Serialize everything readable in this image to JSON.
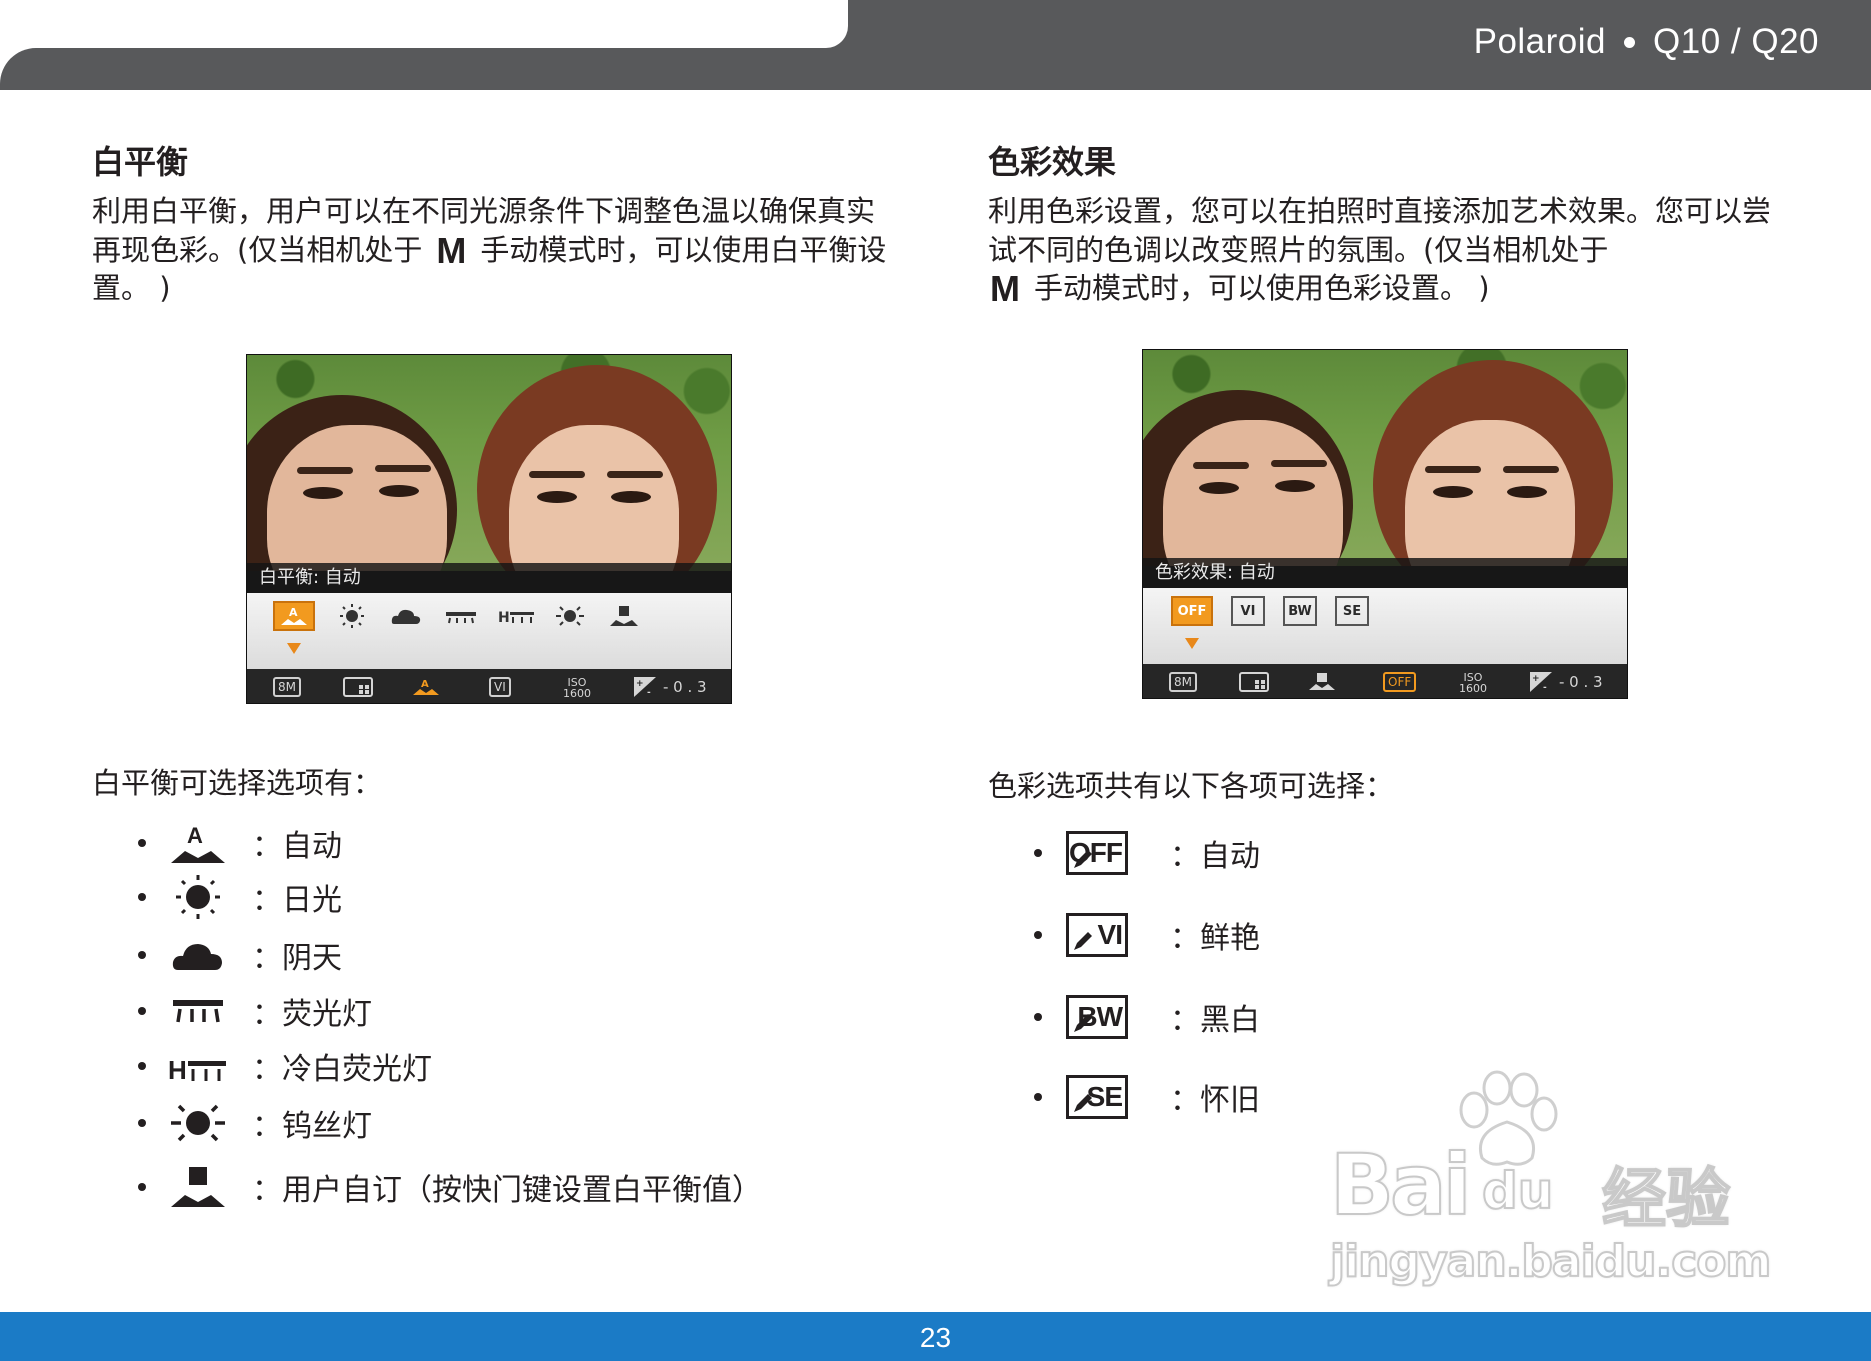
{
  "header": {
    "brand": "Polaroid",
    "model": "Q10 / Q20"
  },
  "footer": {
    "page_number": "23"
  },
  "white_balance": {
    "title": "白平衡",
    "desc_part1": "利用白平衡，用户可以在不同光源条件下调整色温以确保真实再现色彩。(仅当相机处于",
    "mode_glyph": "M",
    "desc_part2": "手动模式时，可以使用白平衡设置。 )",
    "screen_label": "白平衡: 自动",
    "list_title": "白平衡可选择选项有：",
    "options": [
      {
        "icon": "awb-auto-icon",
        "label": "：自动"
      },
      {
        "icon": "daylight-sun-icon",
        "label": "：日光"
      },
      {
        "icon": "cloudy-icon",
        "label": "：阴天"
      },
      {
        "icon": "fluorescent-icon",
        "label": "：荧光灯"
      },
      {
        "icon": "fluorescent-h-icon",
        "label": "：冷白荧光灯"
      },
      {
        "icon": "tungsten-icon",
        "label": "：钨丝灯"
      },
      {
        "icon": "custom-wb-icon",
        "label": "：用户自订（按快门键设置白平衡值）"
      }
    ]
  },
  "color_effect": {
    "title": "色彩效果",
    "desc_part1": "利用色彩设置，您可以在拍照时直接添加艺术效果。您可以尝试不同的色调以改变照片的氛围。(仅当相机处于",
    "mode_glyph": "M",
    "desc_part2": "手动模式时，可以使用色彩设置。 )",
    "screen_label": "色彩效果: 自动",
    "list_title": "色彩选项共有以下各项可选择：",
    "options": [
      {
        "icon": "color-off-icon",
        "code": "OFF",
        "label": "：自动"
      },
      {
        "icon": "color-vivid-icon",
        "code": "VI",
        "label": "：鲜艳"
      },
      {
        "icon": "color-bw-icon",
        "code": "BW",
        "label": "：黑白"
      },
      {
        "icon": "color-sepia-icon",
        "code": "SE",
        "label": "：怀旧"
      }
    ]
  },
  "screen_common": {
    "size_label": "8M",
    "iso_label": "ISO",
    "iso_value": "1600",
    "ev_value": "- 0 . 3",
    "color_codes": [
      "OFF",
      "VI",
      "BW",
      "SE"
    ]
  },
  "watermark": {
    "brand": "Bai",
    "du": "du",
    "suffix": "经验",
    "url": "jingyan.baidu.com"
  },
  "colors": {
    "header": "#58595b",
    "footer": "#1b7bc6",
    "selection": "#f29a1f"
  }
}
